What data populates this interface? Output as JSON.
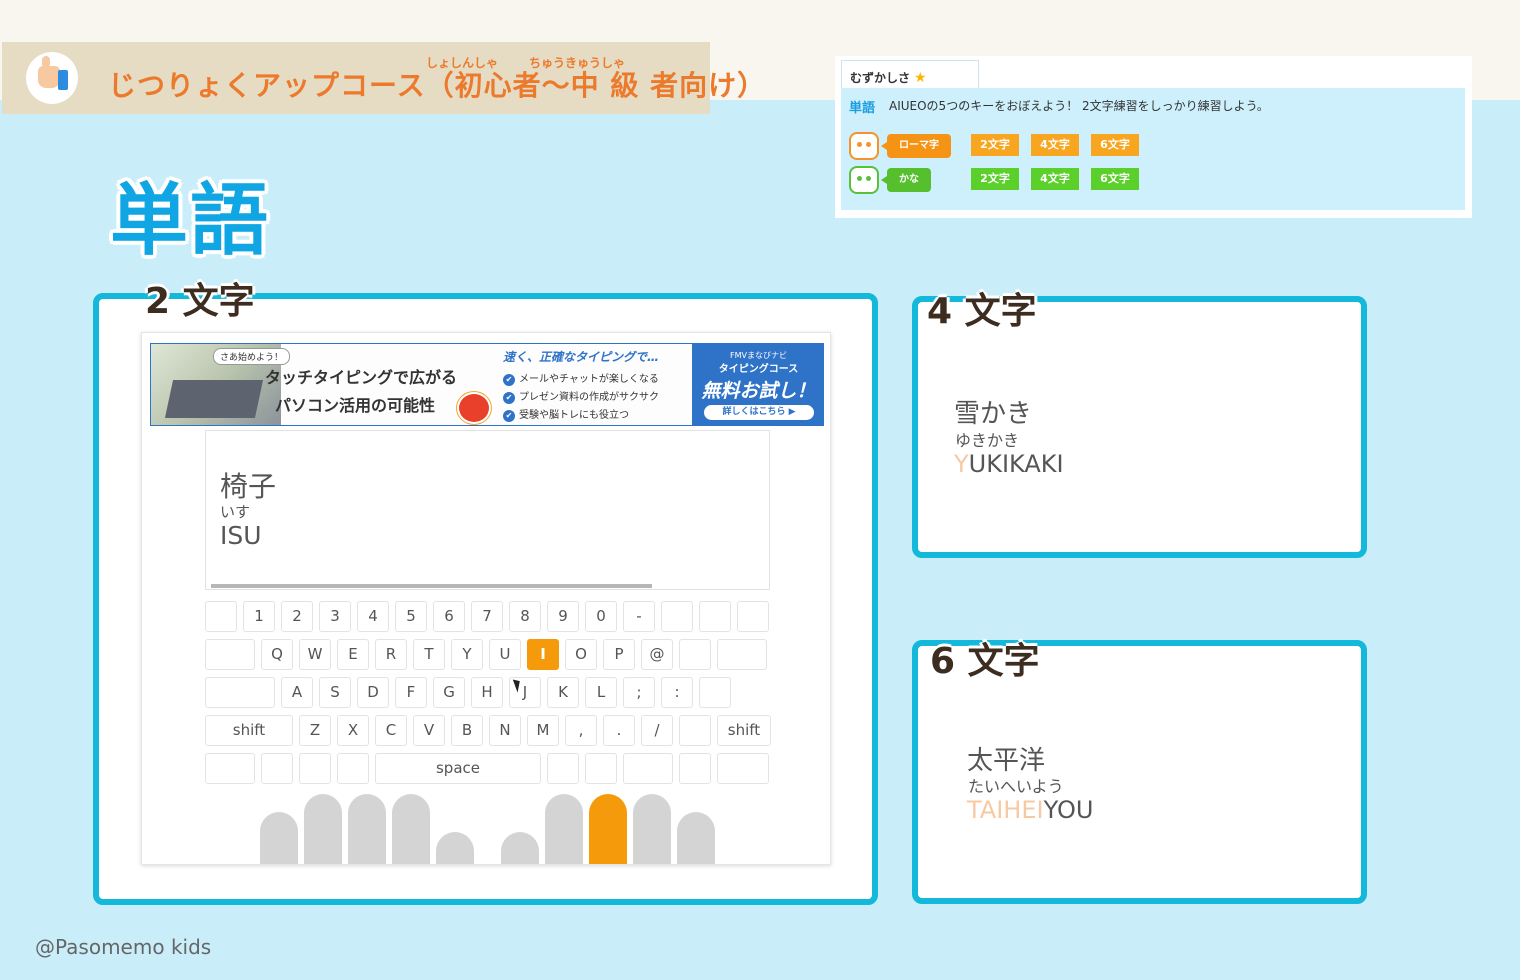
{
  "course": {
    "title": "じつりょくアップコース（初心者〜中 級 者向け）",
    "ruby_1": "しょしんしゃ",
    "ruby_2": "ちゅうきゅうしゃ"
  },
  "page_title": "単語",
  "difficulty": {
    "tab_label": "むずかしさ",
    "star": "★",
    "category_label": "単語",
    "description": "AIUEOの5つのキーをおぼえよう！ 2文字練習をしっかり練習しよう。",
    "romaji_row": {
      "mode": "ローマ字",
      "buttons": [
        "2文字",
        "4文字",
        "6文字"
      ]
    },
    "kana_row": {
      "mode": "かな",
      "buttons": [
        "2文字",
        "4文字",
        "6文字"
      ]
    }
  },
  "panels": {
    "two": {
      "heading": "2 文字"
    },
    "four": {
      "heading": "4 文字",
      "kanji": "雪かき",
      "kana": "ゆきかき",
      "romaji_typed": "Y",
      "romaji_rest": "UKIKAKI"
    },
    "six": {
      "heading": "6 文字",
      "kanji": "太平洋",
      "kana": "たいへいよう",
      "romaji_typed": "TAIHEI",
      "romaji_rest": "YOU"
    }
  },
  "ad": {
    "bubble": "さあ始めよう！",
    "line1": "タッチタイピングで広がる",
    "line2": "パソコン活用の可能性",
    "mid_title": "速く、正確なタイピングで…",
    "checks": [
      "メールやチャットが楽しくなる",
      "プレゼン資料の作成がサクサク",
      "受験や脳トレにも役立つ"
    ],
    "cta_top": "FMVまなびナビ",
    "cta_sub": "タイピングコース",
    "cta_main": "無料お試し！",
    "cta_button": "詳しくはこちら ▶"
  },
  "game": {
    "kanji": "椅子",
    "kana": "いす",
    "romaji": "ISU",
    "progress": 0.78,
    "active_key": "I",
    "active_finger_index": 7
  },
  "keyboard": {
    "row1": [
      "",
      "1",
      "2",
      "3",
      "4",
      "5",
      "6",
      "7",
      "8",
      "9",
      "0",
      "-",
      "",
      "",
      ""
    ],
    "row2": [
      "",
      "Q",
      "W",
      "E",
      "R",
      "T",
      "Y",
      "U",
      "I",
      "O",
      "P",
      "@",
      "",
      ""
    ],
    "row3": [
      "",
      "A",
      "S",
      "D",
      "F",
      "G",
      "H",
      "J",
      "K",
      "L",
      ";",
      ":",
      ""
    ],
    "row4": [
      "shift",
      "Z",
      "X",
      "C",
      "V",
      "B",
      "N",
      "M",
      ",",
      ".",
      "/",
      "",
      "shift"
    ],
    "row5": [
      "",
      "",
      "",
      "",
      "space",
      "",
      "",
      "",
      "",
      ""
    ]
  },
  "credit": "@Pasomemo kids",
  "colors": {
    "accent_blue": "#13b8da",
    "title_blue": "#10a5e3",
    "orange": "#f59a0a",
    "green": "#55bf2e",
    "course_orange": "#ec7a2c"
  }
}
